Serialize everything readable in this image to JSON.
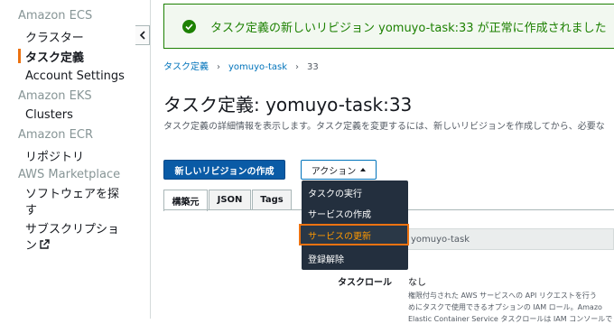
{
  "sidebar": {
    "ecs_heading": "Amazon ECS",
    "clusters": "クラスター",
    "task_definitions": "タスク定義",
    "account_settings": "Account Settings",
    "eks_heading": "Amazon EKS",
    "eks_clusters": "Clusters",
    "ecr_heading": "Amazon ECR",
    "repositories": "リポジトリ",
    "marketplace_heading": "AWS Marketplace",
    "software_line1": "ソフトウェアを探",
    "software_line2": "す",
    "subscriptions_line1": "サブスクリプショ",
    "subscriptions_line2": "ン",
    "external_icon": "external-link-icon",
    "collapse_icon": "chevron-left-icon"
  },
  "flash": {
    "icon": "check-circle-icon",
    "message": "タスク定義の新しいリビジョン yomuyo-task:33 が正常に作成されました"
  },
  "breadcrumb": {
    "root": "タスク定義",
    "family": "yomuyo-task",
    "revision": "33"
  },
  "page": {
    "title": "タスク定義: yomuyo-task:33",
    "description": "タスク定義の詳細情報を表示します。タスク定義を変更するには、新しいリビジョンを作成してから、必要な"
  },
  "buttons": {
    "create_revision": "新しいリビジョンの作成",
    "actions": "アクション"
  },
  "tabs": [
    "構築元",
    "JSON",
    "Tags"
  ],
  "action_menu": {
    "items": [
      "タスクの実行",
      "サービスの作成",
      "サービスの更新",
      "登録解除"
    ],
    "highlighted_index": 2
  },
  "details": {
    "family_value": "yomuyo-task",
    "task_role_label": "タスクロール",
    "task_role_value": "なし",
    "help_line1": "権限付与された AWS サービスへの API リクエストを行う",
    "help_line2": "めにタスクで使用できるオプションの IAM ロール。Amazo",
    "help_line3": "Elastic Container Service タスクロールは IAM コンソールで"
  },
  "colors": {
    "accent_orange": "#ec7211",
    "link_blue": "#0073bb",
    "success_green": "#1d8102",
    "menu_bg": "#232f3e",
    "primary_button": "#0a5ba6"
  }
}
